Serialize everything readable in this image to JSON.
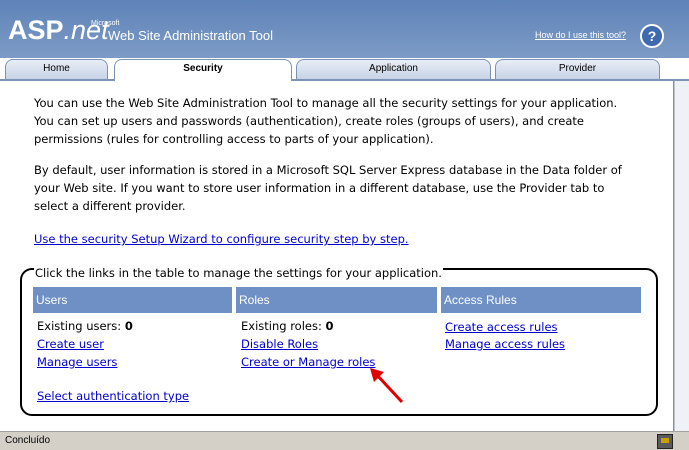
{
  "header": {
    "logo_main": "ASP",
    "logo_net": ".net",
    "logo_ms": "Microsoft",
    "title": "Web Site Administration Tool",
    "help_link": "How do I use this tool?",
    "help_icon": "question-icon"
  },
  "tabs": [
    {
      "label": "Home",
      "active": false
    },
    {
      "label": "Security",
      "active": true
    },
    {
      "label": "Application",
      "active": false
    },
    {
      "label": "Provider",
      "active": false
    }
  ],
  "content": {
    "intro": "You can use the Web Site Administration Tool to manage all the security settings for your application. You can set up users and passwords (authentication), create roles (groups of users), and create permissions (rules for controlling access to parts of your application).",
    "storage_info": "By default, user information is stored in a Microsoft SQL Server Express database in the Data folder of your Web site. If you want to store user information in a different database, use the Provider tab to select a different provider.",
    "wizard_link": "Use the security Setup Wizard to configure security step by step.",
    "table_intro": "Click the links in the table to manage the settings for your application."
  },
  "table": {
    "users": {
      "header": "Users",
      "existing_label": "Existing users:",
      "existing_count": "0",
      "create": "Create user",
      "manage": "Manage users",
      "auth_type": "Select authentication type"
    },
    "roles": {
      "header": "Roles",
      "existing_label": "Existing roles:",
      "existing_count": "0",
      "disable": "Disable Roles",
      "create_manage": "Create or Manage roles"
    },
    "access": {
      "header": "Access Rules",
      "create": "Create access rules",
      "manage": "Manage access rules"
    }
  },
  "statusbar": {
    "text": "Concluído",
    "icon": "security-zone-icon"
  },
  "colors": {
    "header_bg": "#6b8dbd",
    "column_header_bg": "#6f90c5",
    "link": "#0000cc",
    "annotation_arrow": "#e00000"
  }
}
